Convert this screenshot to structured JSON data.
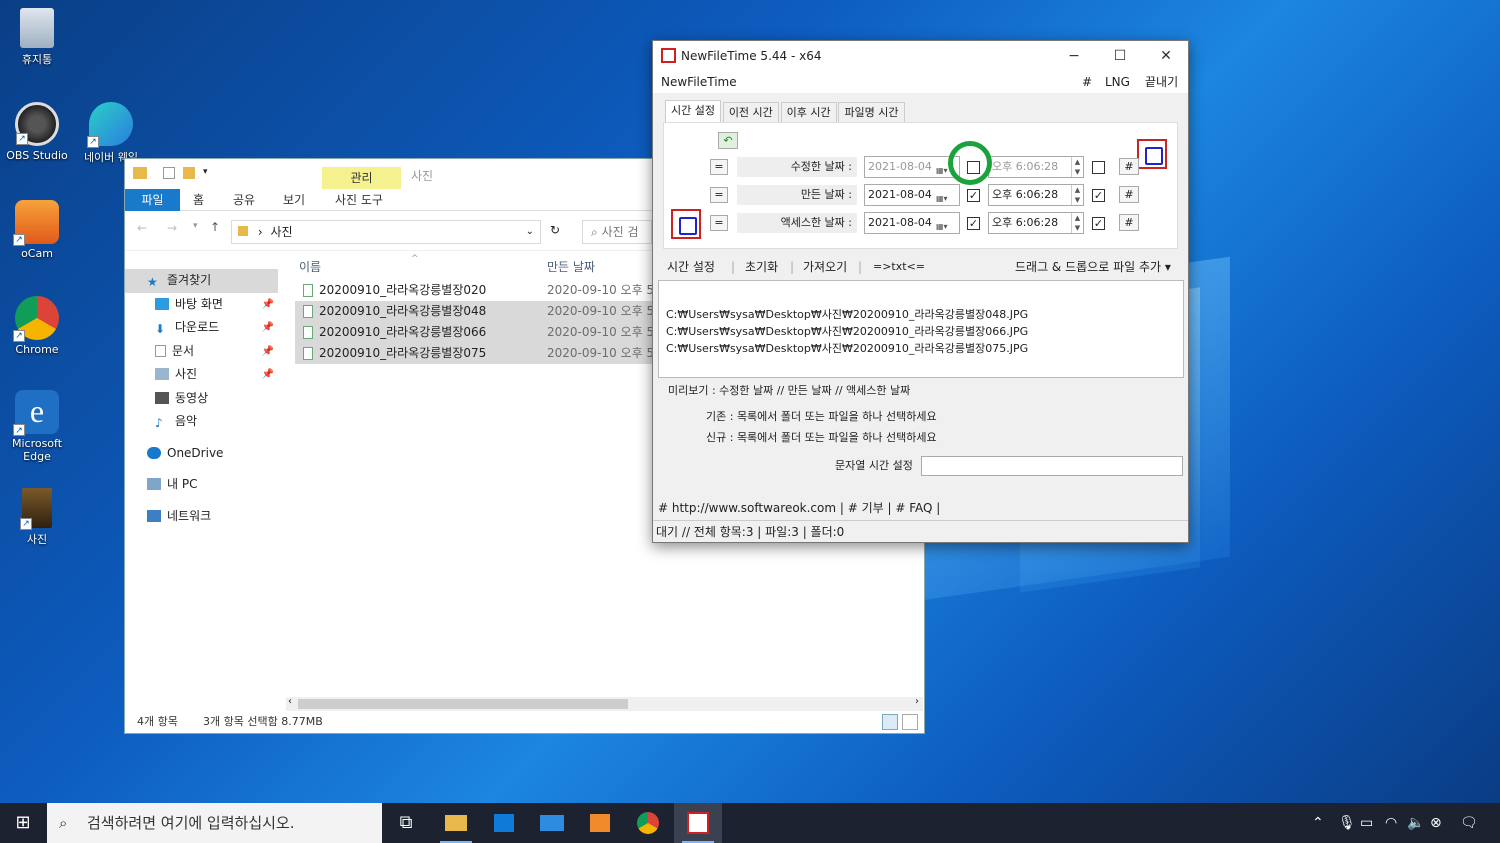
{
  "desktop": {
    "icons": [
      {
        "label": "휴지통"
      },
      {
        "label": "OBS Studio"
      },
      {
        "label": "네이버 웨일"
      },
      {
        "label": "oCam"
      },
      {
        "label": "Chrome"
      },
      {
        "label": "Microsoft Edge"
      },
      {
        "label": "사진"
      }
    ]
  },
  "explorer": {
    "title_context": "사진",
    "manage_tab": "관리",
    "tabs": [
      "파일",
      "홈",
      "공유",
      "보기",
      "사진 도구"
    ],
    "address": "사진",
    "search_placeholder": "사진 검",
    "nav": {
      "quick_access": "즐겨찾기",
      "items": [
        "바탕 화면",
        "다운로드",
        "문서",
        "사진",
        "동영상",
        "음악"
      ],
      "onedrive": "OneDrive",
      "this_pc": "내 PC",
      "network": "네트워크"
    },
    "columns": {
      "name": "이름",
      "date": "만든 날짜"
    },
    "files": [
      {
        "name": "20200910_라라옥강릉별장020",
        "date": "2020-09-10 오후 5:4",
        "selected": false
      },
      {
        "name": "20200910_라라옥강릉별장048",
        "date": "2020-09-10 오후 5:4",
        "selected": true
      },
      {
        "name": "20200910_라라옥강릉별장066",
        "date": "2020-09-10 오후 5:4",
        "selected": true
      },
      {
        "name": "20200910_라라옥강릉별장075",
        "date": "2020-09-10 오후 5:4",
        "selected": true
      }
    ],
    "status": {
      "count": "4개 항목",
      "selection": "3개 항목 선택함 8.77MB"
    }
  },
  "nft": {
    "title": "NewFileTime 5.44 - x64",
    "app_name": "NewFileTime",
    "menu": {
      "hash": "#",
      "lng": "LNG",
      "exit": "끝내기"
    },
    "tabs": [
      "시간 설정",
      "이전 시간",
      "이후 시간",
      "파일명 시간"
    ],
    "rows": [
      {
        "eq": "=",
        "label": "수정한 날짜 :",
        "date": "2021-08-04",
        "time": "오후  6:06:28",
        "enabled": false,
        "hash": "#"
      },
      {
        "eq": "=",
        "label": "만든 날짜 :",
        "date": "2021-08-04",
        "time": "오후  6:06:28",
        "enabled": true,
        "hash": "#"
      },
      {
        "eq": "=",
        "label": "액세스한 날짜 :",
        "date": "2021-08-04",
        "time": "오후  6:06:28",
        "enabled": true,
        "hash": "#"
      }
    ],
    "toolbar": {
      "set": "시간 설정",
      "reset": "초기화",
      "import": "가져오기",
      "txt": "=>txt<=",
      "dragdrop": "드래그 & 드롭으로 파일 추가 ▾"
    },
    "file_list": [
      "C:₩Users₩sysa₩Desktop₩사진₩20200910_라라옥강릉별장048.JPG",
      "C:₩Users₩sysa₩Desktop₩사진₩20200910_라라옥강릉별장066.JPG",
      "C:₩Users₩sysa₩Desktop₩사진₩20200910_라라옥강릉별장075.JPG"
    ],
    "preview": {
      "header": "미리보기 :   수정한 날짜   //   만든 날짜   //   액세스한 날짜",
      "existing": "기존 :  목록에서 폴더 또는 파일을 하나 선택하세요",
      "new": "신규 :  목록에서 폴더 또는 파일을 하나 선택하세요",
      "string_label": "문자열 시간 설정"
    },
    "links": "# http://www.softwareok.com  |  # 기부  |  # FAQ  |",
    "status": "대기 // 전체 항목:3 | 파일:3 | 폴더:0"
  },
  "taskbar": {
    "search_placeholder": "검색하려면 여기에 입력하십시오."
  }
}
